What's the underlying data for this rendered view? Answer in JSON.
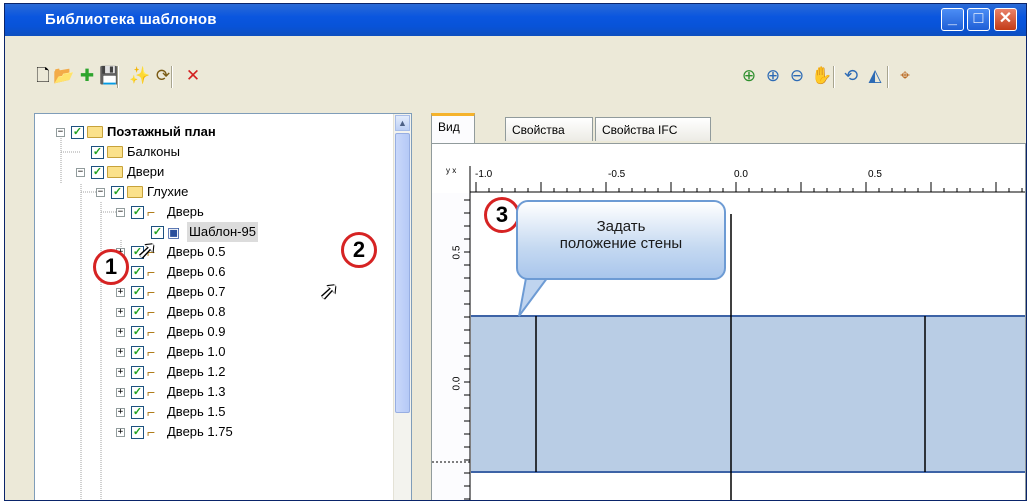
{
  "window": {
    "title": "Библиотека шаблонов"
  },
  "titlebar_buttons": {
    "minimize": "_",
    "maximize": "□",
    "close": "✕"
  },
  "toolbar_left": [
    {
      "name": "new-icon",
      "glyph": "🗋",
      "color": "#000000"
    },
    {
      "name": "open-icon",
      "glyph": "📂",
      "color": "#c9a227"
    },
    {
      "name": "add-icon",
      "glyph": "✚",
      "color": "#2ea52e"
    },
    {
      "name": "save-icon",
      "glyph": "💾",
      "color": "#1f3f8f"
    },
    {
      "name": "new-template-icon",
      "glyph": "✨",
      "color": "#7a5a13"
    },
    {
      "name": "import-icon",
      "glyph": "⟳",
      "color": "#7a5a13"
    },
    {
      "name": "delete-icon",
      "glyph": "✕",
      "color": "#d32020"
    }
  ],
  "toolbar_right": [
    {
      "name": "zoom-fit-icon",
      "glyph": "⊕",
      "color": "#2d8f2d"
    },
    {
      "name": "zoom-in-icon",
      "glyph": "⊕",
      "color": "#2d6bb5"
    },
    {
      "name": "zoom-out-icon",
      "glyph": "⊖",
      "color": "#2d6bb5"
    },
    {
      "name": "pan-icon",
      "glyph": "✋",
      "color": "#8a6d1a"
    },
    {
      "name": "rotate-icon",
      "glyph": "⟲",
      "color": "#2d6bb5"
    },
    {
      "name": "mirror-icon",
      "glyph": "◭",
      "color": "#2d6bb5"
    },
    {
      "name": "snap-icon",
      "glyph": "⌖",
      "color": "#b8641a"
    }
  ],
  "tree": {
    "items": [
      {
        "label": "Поэтажный план",
        "kind": "folder",
        "expander": "−",
        "bold": true
      },
      {
        "label": "Балконы",
        "kind": "folder",
        "expander": ""
      },
      {
        "label": "Двери",
        "kind": "folder",
        "expander": "−"
      },
      {
        "label": "Глухие",
        "kind": "folder",
        "expander": "−"
      },
      {
        "label": "Дверь",
        "kind": "door",
        "expander": "−"
      },
      {
        "label": "Шаблон-95",
        "kind": "template",
        "expander": ""
      },
      {
        "label": "Дверь 0.5",
        "kind": "door",
        "expander": "+"
      },
      {
        "label": "Дверь 0.6",
        "kind": "door",
        "expander": "+"
      },
      {
        "label": "Дверь 0.7",
        "kind": "door",
        "expander": "+"
      },
      {
        "label": "Дверь 0.8",
        "kind": "door",
        "expander": "+"
      },
      {
        "label": "Дверь 0.9",
        "kind": "door",
        "expander": "+"
      },
      {
        "label": "Дверь 1.0",
        "kind": "door",
        "expander": "+"
      },
      {
        "label": "Дверь 1.2",
        "kind": "door",
        "expander": "+"
      },
      {
        "label": "Дверь 1.3",
        "kind": "door",
        "expander": "+"
      },
      {
        "label": "Дверь 1.5",
        "kind": "door",
        "expander": "+"
      },
      {
        "label": "Дверь 1.75",
        "kind": "door",
        "expander": "+"
      }
    ]
  },
  "tabs": [
    {
      "label": "Вид",
      "active": true
    },
    {
      "label": "Свойства",
      "active": false
    },
    {
      "label": "Свойства IFC",
      "active": false
    }
  ],
  "ruler": {
    "top_labels": [
      "-1.0",
      "-0.5",
      "0.0",
      "0.5"
    ],
    "left_labels": [
      "0.5",
      "0.0"
    ],
    "axis_glyph": "y x"
  },
  "callouts": {
    "one": "1",
    "two": "2",
    "three": "3",
    "bubble_line1": "Задать",
    "bubble_line2": "положение стены"
  },
  "colors": {
    "wall_fill": "#b9cde5",
    "wall_stroke": "#3d63a6",
    "annotation_red": "#d62323",
    "selected_bg": "#dcdcdc"
  }
}
